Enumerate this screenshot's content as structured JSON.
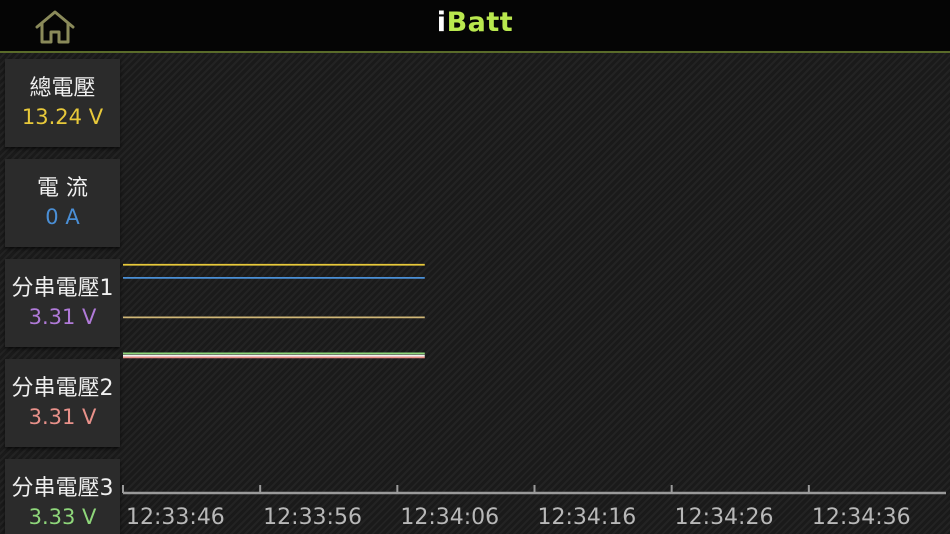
{
  "header": {
    "title_i": "i",
    "title_rest": "Batt",
    "home_icon": "home-icon"
  },
  "colors": {
    "accent": "#b9e84e",
    "header_border": "#5a6b2a",
    "total_voltage": "#e8c93a",
    "current": "#4a8fd6",
    "cell1": "#b07ad8",
    "cell2": "#e8918a",
    "cell3": "#8ed67a"
  },
  "sidebar": {
    "cards": [
      {
        "label": "總電壓",
        "value": "13.24 V",
        "color": "#e8c93a"
      },
      {
        "label": "電 流",
        "value": "0 A",
        "color": "#4a8fd6"
      },
      {
        "label": "分串電壓1",
        "value": "3.31 V",
        "color": "#b07ad8"
      },
      {
        "label": "分串電壓2",
        "value": "3.31 V",
        "color": "#e8918a"
      },
      {
        "label": "分串電壓3",
        "value": "3.33 V",
        "color": "#8ed67a"
      }
    ]
  },
  "chart_data": {
    "type": "line",
    "x_tick_labels": [
      "12:33:46",
      "12:33:56",
      "12:34:06",
      "12:34:16",
      "12:34:26",
      "12:34:36"
    ],
    "x_range": [
      "12:33:46",
      "12:34:46"
    ],
    "data_end": "12:34:08",
    "grid": false,
    "series": [
      {
        "color": "#e8c93a",
        "level": 0.52
      },
      {
        "color": "#4a8fd6",
        "level": 0.49
      },
      {
        "color": "#cfb676",
        "level": 0.4
      },
      {
        "color": "#8ed67a",
        "level": 0.318
      },
      {
        "color": "#f2f2f2",
        "level": 0.313
      },
      {
        "color": "#e8918a",
        "level": 0.309
      }
    ]
  }
}
